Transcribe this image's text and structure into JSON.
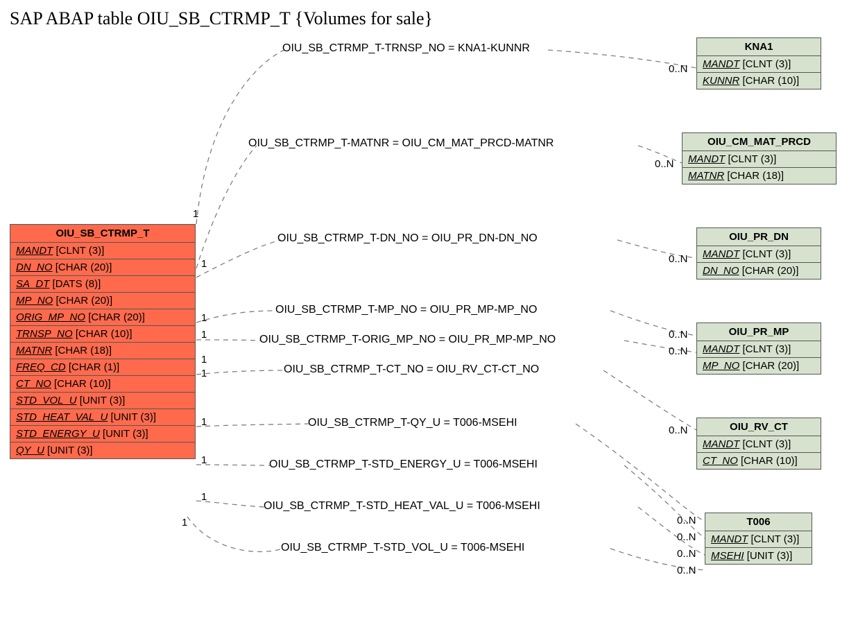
{
  "title": "SAP ABAP table OIU_SB_CTRMP_T {Volumes for sale}",
  "main": {
    "name": "OIU_SB_CTRMP_T",
    "fields": [
      {
        "f": "MANDT",
        "t": "[CLNT (3)]"
      },
      {
        "f": "DN_NO",
        "t": "[CHAR (20)]"
      },
      {
        "f": "SA_DT",
        "t": "[DATS (8)]"
      },
      {
        "f": "MP_NO",
        "t": "[CHAR (20)]"
      },
      {
        "f": "ORIG_MP_NO",
        "t": "[CHAR (20)]"
      },
      {
        "f": "TRNSP_NO",
        "t": "[CHAR (10)]"
      },
      {
        "f": "MATNR",
        "t": "[CHAR (18)]"
      },
      {
        "f": "FREQ_CD",
        "t": "[CHAR (1)]"
      },
      {
        "f": "CT_NO",
        "t": "[CHAR (10)]"
      },
      {
        "f": "STD_VOL_U",
        "t": "[UNIT (3)]"
      },
      {
        "f": "STD_HEAT_VAL_U",
        "t": "[UNIT (3)]"
      },
      {
        "f": "STD_ENERGY_U",
        "t": "[UNIT (3)]"
      },
      {
        "f": "QY_U",
        "t": "[UNIT (3)]"
      }
    ]
  },
  "refs": [
    {
      "name": "KNA1",
      "fields": [
        {
          "f": "MANDT",
          "t": "[CLNT (3)]"
        },
        {
          "f": "KUNNR",
          "t": "[CHAR (10)]"
        }
      ]
    },
    {
      "name": "OIU_CM_MAT_PRCD",
      "fields": [
        {
          "f": "MANDT",
          "t": "[CLNT (3)]"
        },
        {
          "f": "MATNR",
          "t": "[CHAR (18)]"
        }
      ]
    },
    {
      "name": "OIU_PR_DN",
      "fields": [
        {
          "f": "MANDT",
          "t": "[CLNT (3)]"
        },
        {
          "f": "DN_NO",
          "t": "[CHAR (20)]"
        }
      ]
    },
    {
      "name": "OIU_PR_MP",
      "fields": [
        {
          "f": "MANDT",
          "t": "[CLNT (3)]"
        },
        {
          "f": "MP_NO",
          "t": "[CHAR (20)]"
        }
      ]
    },
    {
      "name": "OIU_RV_CT",
      "fields": [
        {
          "f": "MANDT",
          "t": "[CLNT (3)]"
        },
        {
          "f": "CT_NO",
          "t": "[CHAR (10)]"
        }
      ]
    },
    {
      "name": "T006",
      "fields": [
        {
          "f": "MANDT",
          "t": "[CLNT (3)]"
        },
        {
          "f": "MSEHI",
          "t": "[UNIT (3)]"
        }
      ]
    }
  ],
  "edges": {
    "e1": "OIU_SB_CTRMP_T-TRNSP_NO = KNA1-KUNNR",
    "e2": "OIU_SB_CTRMP_T-MATNR = OIU_CM_MAT_PRCD-MATNR",
    "e3": "OIU_SB_CTRMP_T-DN_NO = OIU_PR_DN-DN_NO",
    "e4": "OIU_SB_CTRMP_T-MP_NO = OIU_PR_MP-MP_NO",
    "e5": "OIU_SB_CTRMP_T-ORIG_MP_NO = OIU_PR_MP-MP_NO",
    "e6": "OIU_SB_CTRMP_T-CT_NO = OIU_RV_CT-CT_NO",
    "e7": "OIU_SB_CTRMP_T-QY_U = T006-MSEHI",
    "e8": "OIU_SB_CTRMP_T-STD_ENERGY_U = T006-MSEHI",
    "e9": "OIU_SB_CTRMP_T-STD_HEAT_VAL_U = T006-MSEHI",
    "e10": "OIU_SB_CTRMP_T-STD_VOL_U = T006-MSEHI"
  },
  "cards": {
    "one": "1",
    "many": "0..N"
  }
}
